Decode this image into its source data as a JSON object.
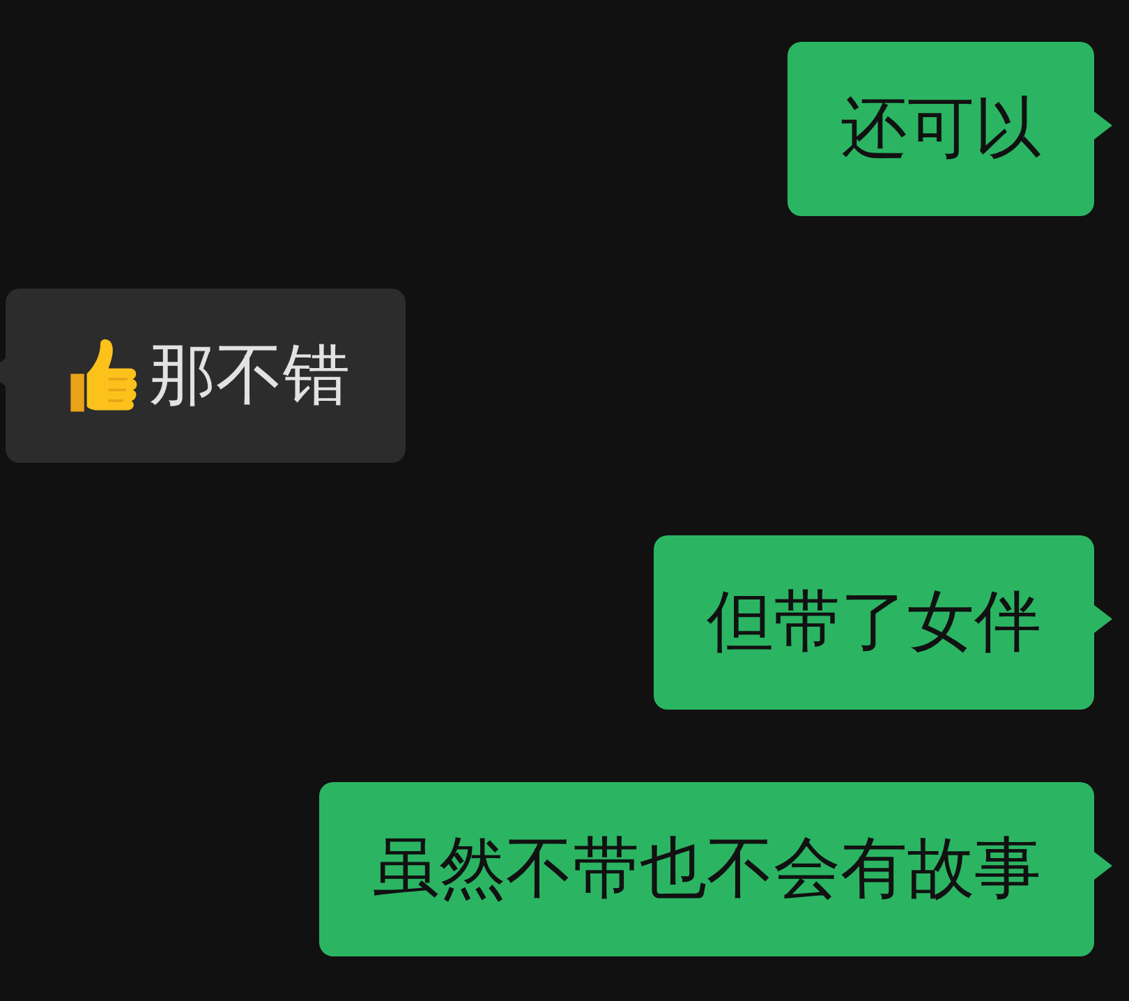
{
  "messages": [
    {
      "outgoing": true,
      "kind": "text",
      "text": "还可以"
    },
    {
      "outgoing": false,
      "kind": "thumbs_text",
      "text": "那不错"
    },
    {
      "outgoing": true,
      "kind": "text",
      "text": "但带了女伴"
    },
    {
      "outgoing": true,
      "kind": "text",
      "text": "虽然不带也不会有故事"
    }
  ]
}
